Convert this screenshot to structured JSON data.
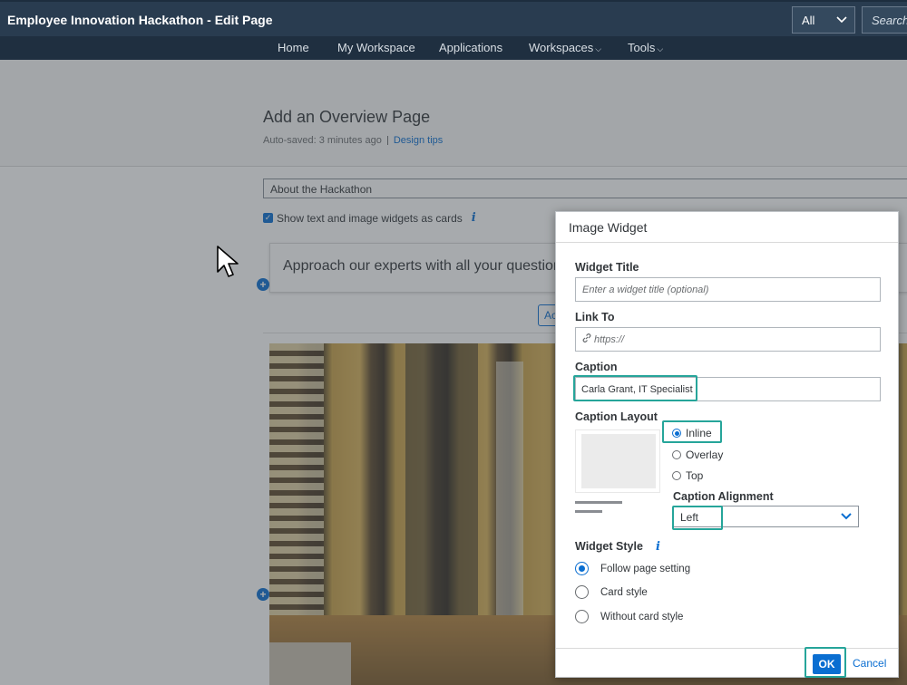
{
  "header": {
    "title": "Employee Innovation Hackathon - Edit Page",
    "scope_value": "All",
    "search_placeholder": "Search"
  },
  "nav": {
    "items": [
      {
        "label": "Home"
      },
      {
        "label": "My Workspace"
      },
      {
        "label": "Applications"
      },
      {
        "label": "Workspaces"
      },
      {
        "label": "Tools"
      }
    ]
  },
  "page": {
    "heading": "Add an Overview Page",
    "autosave": "Auto-saved: 3 minutes ago",
    "design_tips": "Design tips",
    "section_title": "About the Hackathon",
    "cards_checkbox_label": "Show text and image widgets as cards",
    "card_text": "Approach our experts with all your questions",
    "add_button_label": "Ac"
  },
  "dialog": {
    "title": "Image Widget",
    "widget_title_label": "Widget Title",
    "widget_title_placeholder": "Enter a widget title (optional)",
    "link_to_label": "Link To",
    "link_placeholder": "https://",
    "caption_label": "Caption",
    "caption_value": "Carla Grant, IT Specialist",
    "caption_layout_label": "Caption Layout",
    "layout_options": [
      {
        "label": "Inline",
        "selected": true
      },
      {
        "label": "Overlay",
        "selected": false
      },
      {
        "label": "Top",
        "selected": false
      }
    ],
    "caption_alignment_label": "Caption Alignment",
    "caption_alignment_value": "Left",
    "widget_style_label": "Widget Style",
    "style_options": [
      {
        "label": "Follow page setting",
        "selected": true
      },
      {
        "label": "Card style",
        "selected": false
      },
      {
        "label": "Without card style",
        "selected": false
      }
    ],
    "ok_label": "OK",
    "cancel_label": "Cancel"
  },
  "colors": {
    "accent": "#0a6ed1",
    "highlight": "#26a59a",
    "shell": "#293c50"
  }
}
